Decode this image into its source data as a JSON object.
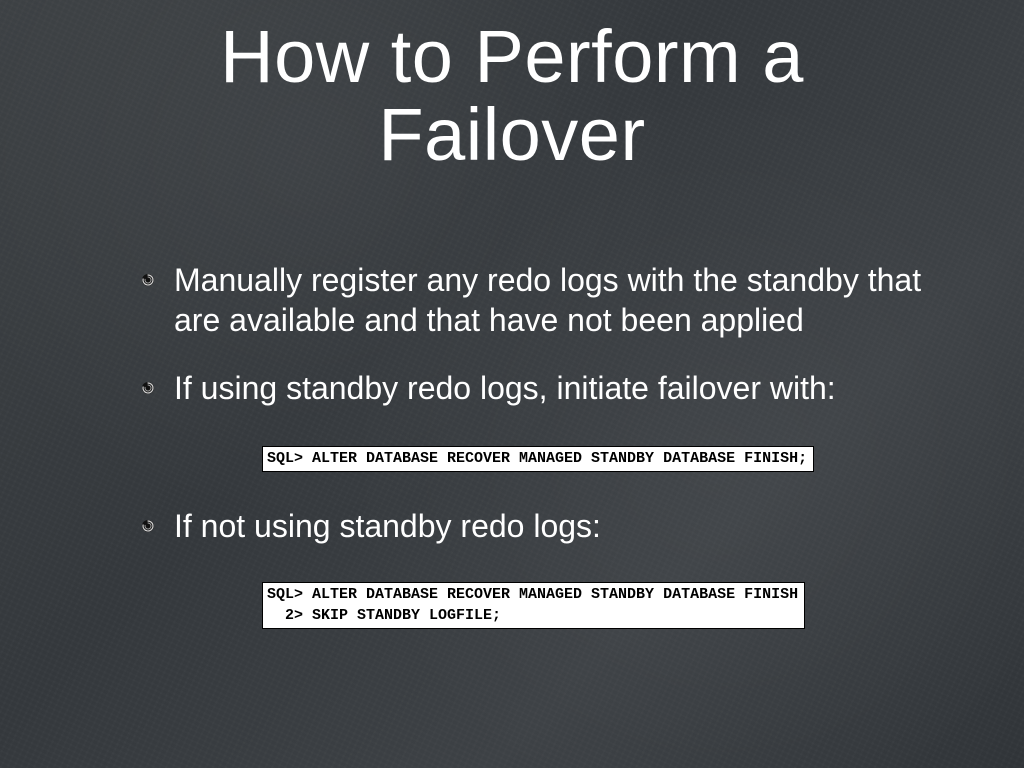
{
  "title_line1": "How to Perform a",
  "title_line2": "Failover",
  "bullets": {
    "b1": "Manually register any redo logs with the standby that are available and that have not been applied",
    "b2": "If using standby redo logs, initiate failover with:",
    "b3": "If not using standby redo logs:"
  },
  "code": {
    "c1": "SQL> ALTER DATABASE RECOVER MANAGED STANDBY DATABASE FINISH;",
    "c2": "SQL> ALTER DATABASE RECOVER MANAGED STANDBY DATABASE FINISH\n  2> SKIP STANDBY LOGFILE;"
  }
}
